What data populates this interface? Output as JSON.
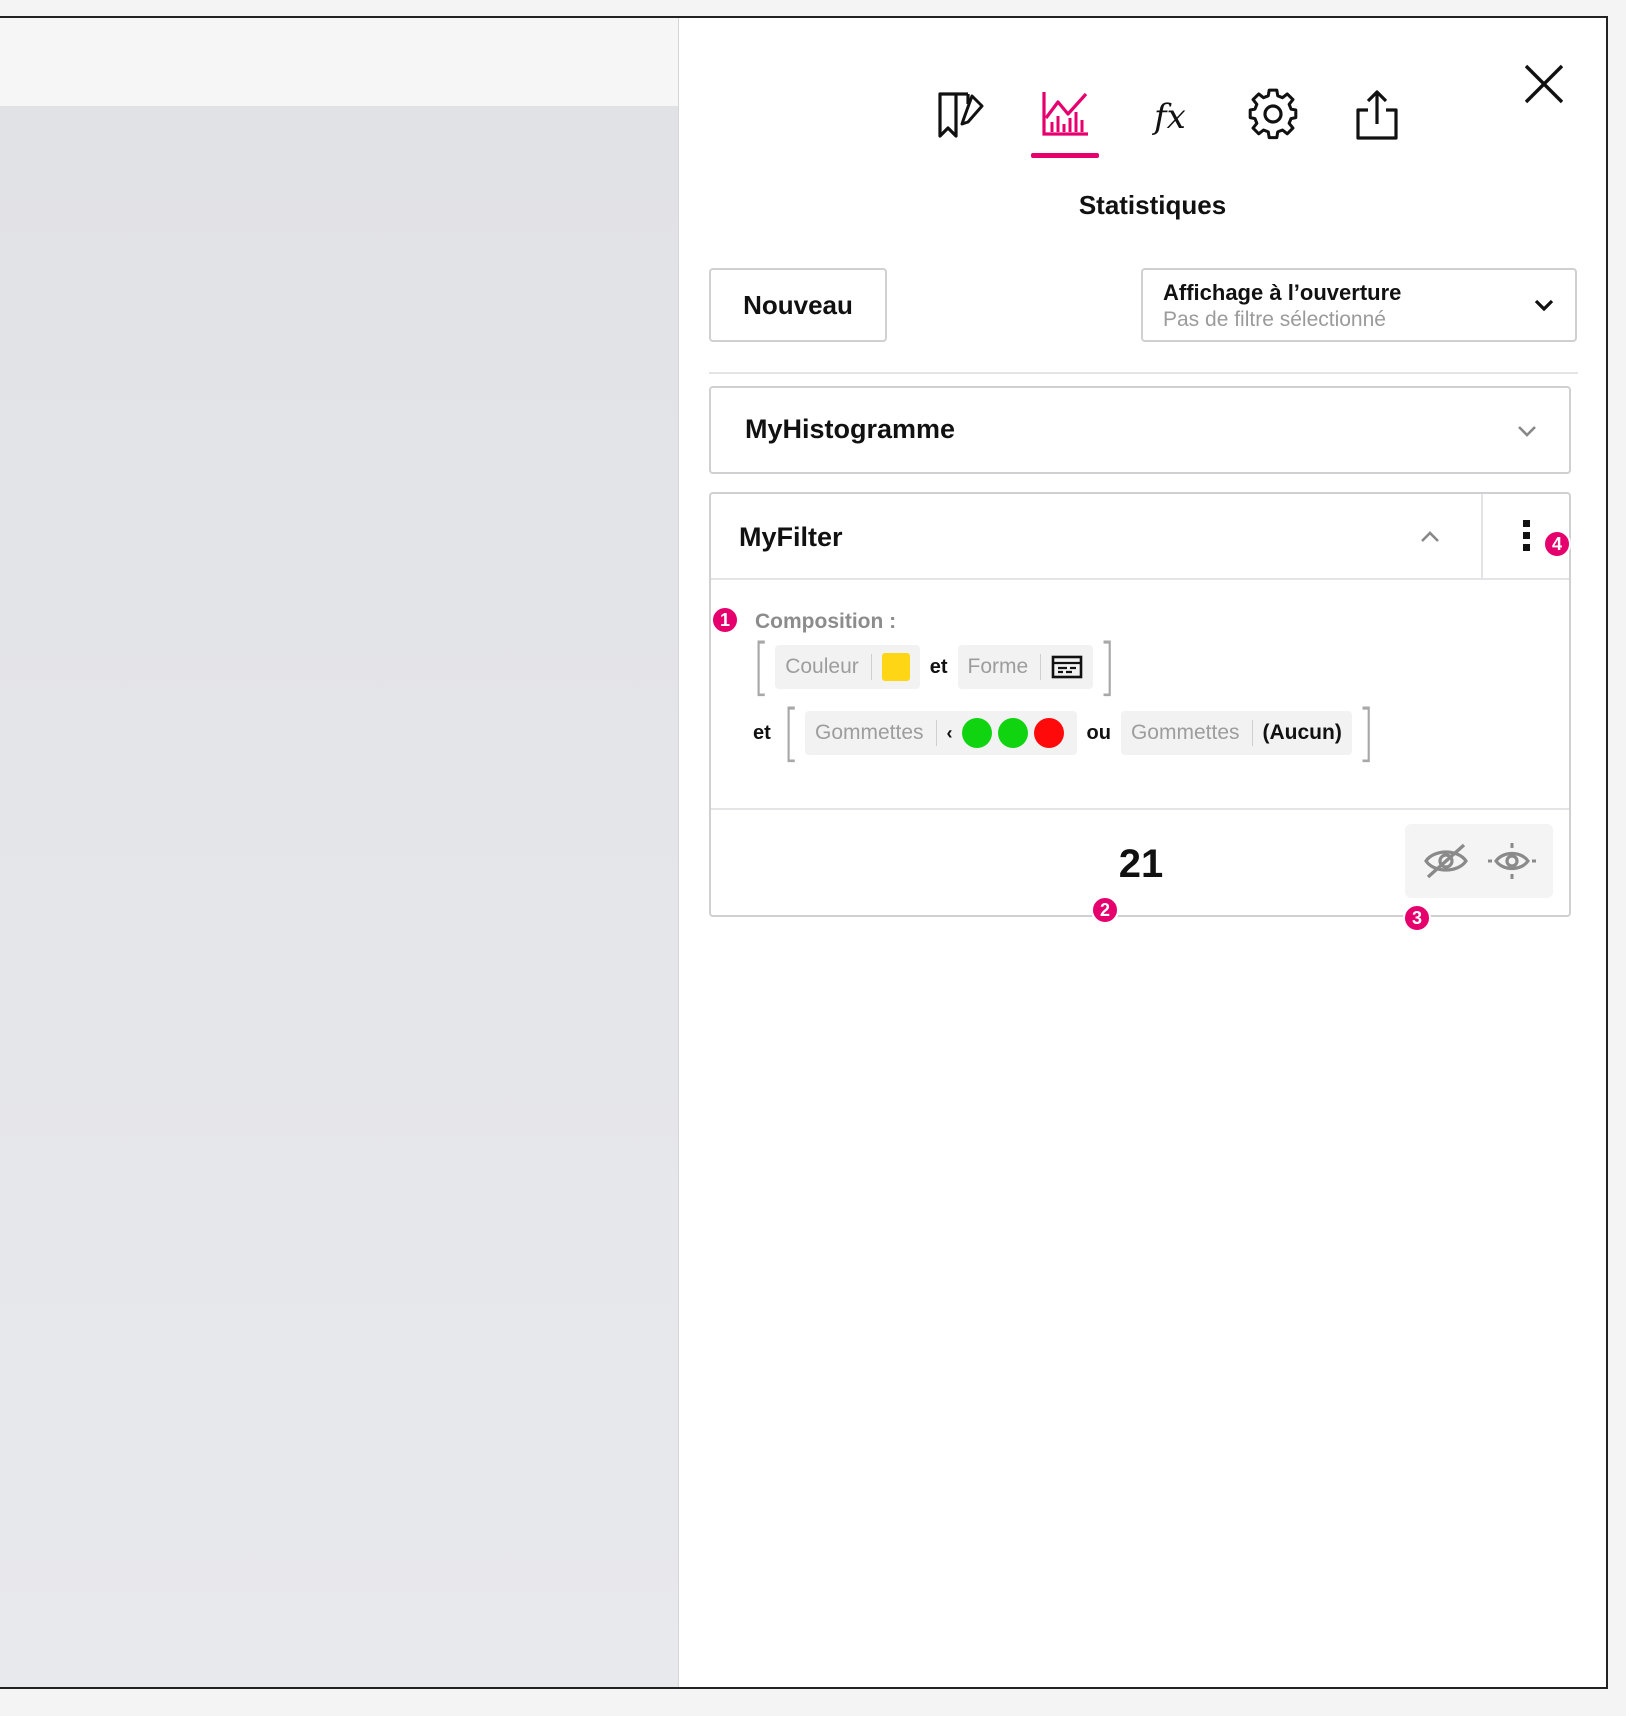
{
  "panel": {
    "title": "Statistiques",
    "tabs": [
      {
        "icon": "bookmark-edit-icon",
        "active": false
      },
      {
        "icon": "chart-icon",
        "active": true
      },
      {
        "icon": "function-icon",
        "active": false
      },
      {
        "icon": "gear-icon",
        "active": false
      },
      {
        "icon": "share-export-icon",
        "active": false
      }
    ],
    "function_label": "fx"
  },
  "actions": {
    "new_label": "Nouveau",
    "display_select": {
      "label": "Affichage à l’ouverture",
      "value": "Pas de filtre sélectionné"
    }
  },
  "items": {
    "histogram": {
      "name": "MyHistogramme"
    },
    "filter": {
      "name": "MyFilter",
      "composition_label": "Composition :",
      "group1": {
        "color_label": "Couleur",
        "color_value": "#ffd615",
        "conj": "et",
        "shape_label": "Forme",
        "shape_icon": "form-icon"
      },
      "group2": {
        "lead_conj": "et",
        "stickers_label": "Gommettes",
        "operator": "‹",
        "dots": [
          "#11d411",
          "#11d411",
          "#ff0a0a"
        ],
        "conj": "ou",
        "stickers2_label": "Gommettes",
        "stickers2_value": "(Aucun)"
      },
      "count": "21"
    }
  },
  "badges": {
    "b1": "1",
    "b2": "2",
    "b3": "3",
    "b4": "4"
  },
  "colors": {
    "accent": "#e5006d"
  }
}
